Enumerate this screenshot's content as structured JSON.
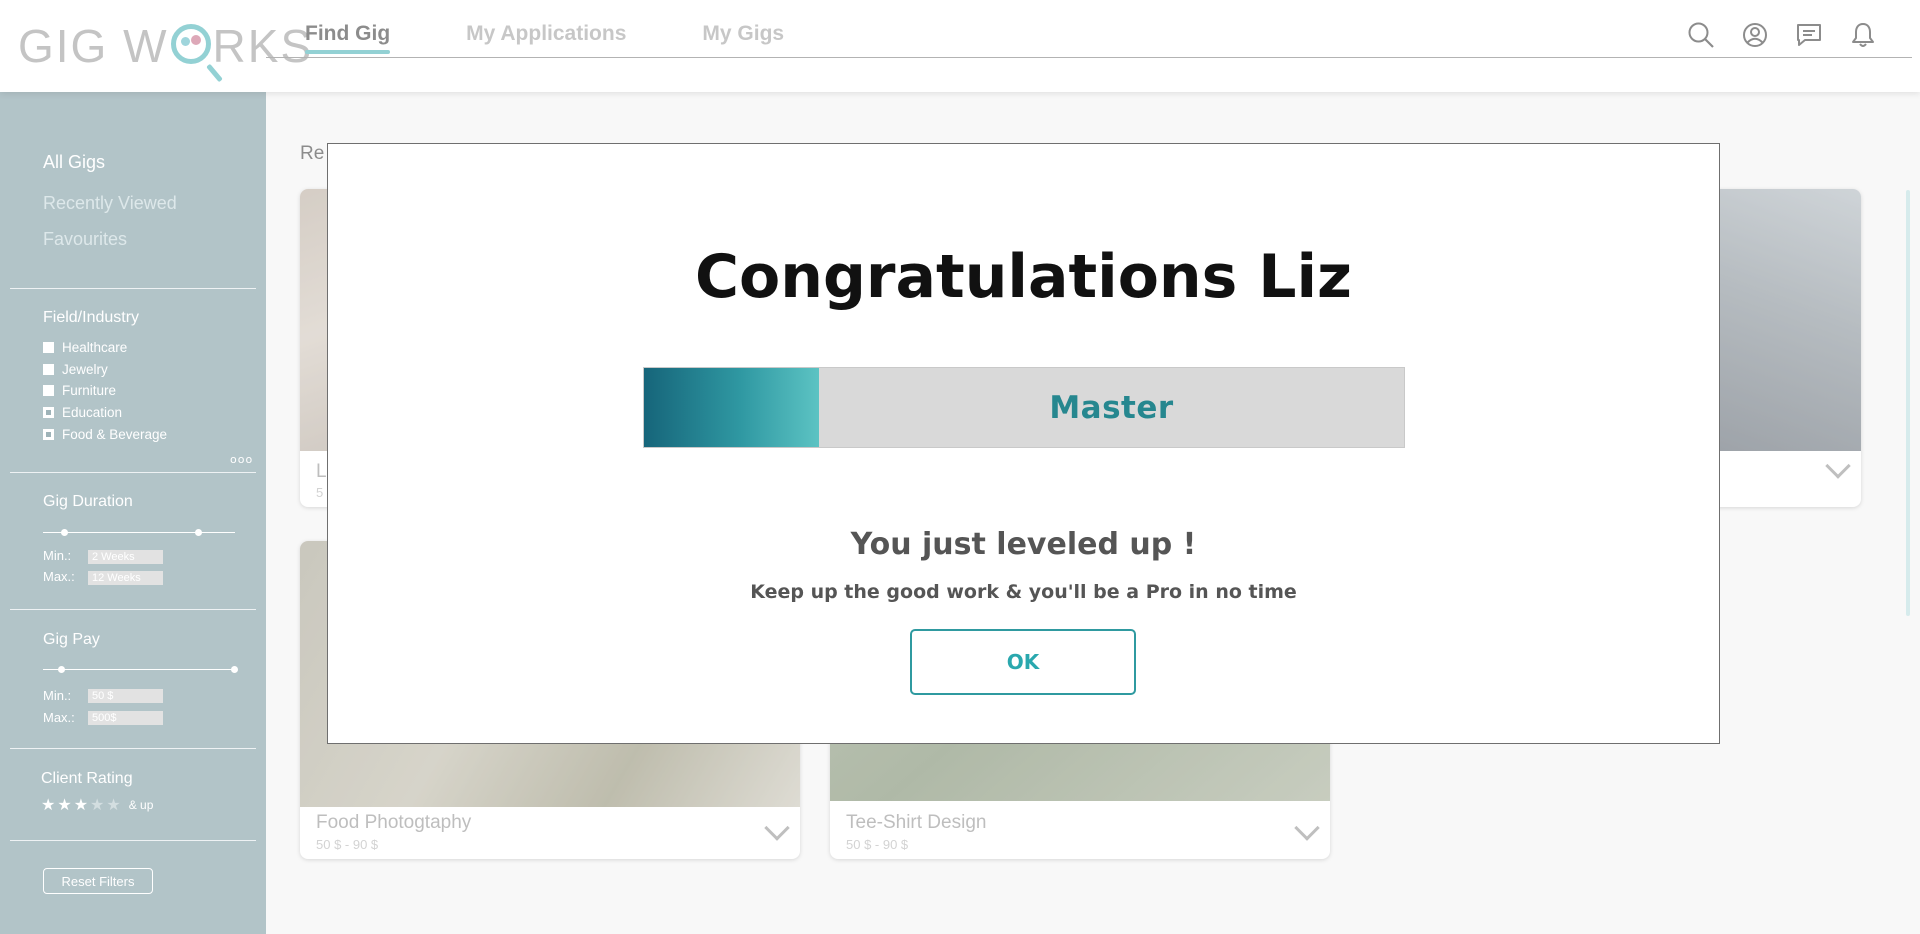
{
  "app": {
    "logo_text_left": "GIG W",
    "logo_text_right": "RKS",
    "accent_color": "#6fc2c6"
  },
  "nav": {
    "items": [
      {
        "label": "Find Gig",
        "active": true
      },
      {
        "label": "My Applications",
        "active": false
      },
      {
        "label": "My Gigs",
        "active": false
      }
    ],
    "icons": [
      "search-icon",
      "account-icon",
      "messages-icon",
      "notifications-icon"
    ]
  },
  "sidebar": {
    "links": [
      "All Gigs",
      "Recently Viewed",
      "Favourites"
    ],
    "field_industry": {
      "heading": "Field/Industry",
      "options": [
        {
          "label": "Healthcare",
          "checked": false
        },
        {
          "label": "Jewelry",
          "checked": false
        },
        {
          "label": "Furniture",
          "checked": false
        },
        {
          "label": "Education",
          "checked": true
        },
        {
          "label": "Food & Beverage",
          "checked": true
        }
      ],
      "more": "ooo"
    },
    "gig_duration": {
      "heading": "Gig Duration",
      "min_label": "Min.:",
      "min_value": "2 Weeks",
      "max_label": "Max.:",
      "max_value": "12 Weeks"
    },
    "gig_pay": {
      "heading": "Gig Pay",
      "min_label": "Min.:",
      "min_value": "50 $",
      "max_label": "Max.:",
      "max_value": "500$"
    },
    "client_rating": {
      "heading": "Client Rating",
      "stars_filled": 3,
      "stars_total": 5,
      "suffix": "& up"
    },
    "reset_label": "Reset Filters"
  },
  "main": {
    "section_title_visible": "Re",
    "cards": [
      {
        "title": "L",
        "sub": "5"
      },
      {
        "title": "Food Photogtaphy",
        "sub": "50 $ - 90 $"
      },
      {
        "title": "Tee-Shirt Design",
        "sub": "50 $ - 90 $"
      }
    ]
  },
  "modal": {
    "title": "Congratulations Liz",
    "level_label": "Master",
    "level_progress": 0.23,
    "subtitle": "You just leveled up !",
    "message": "Keep up the good work & you'll be a Pro in no time",
    "ok_label": "OK"
  }
}
